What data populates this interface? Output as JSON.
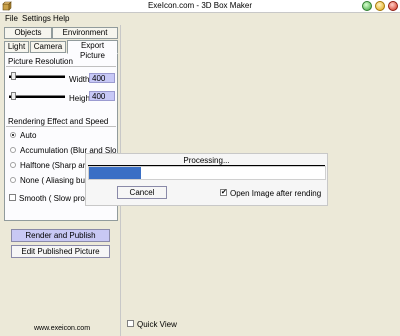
{
  "window": {
    "title": "ExeIcon.com - 3D Box Maker"
  },
  "menu": {
    "file": "File",
    "settings": "Settings",
    "help": "Help"
  },
  "tabs_row1": [
    "Objects",
    "Environment"
  ],
  "tabs_row2": [
    "Light",
    "Camera",
    "Export Picture"
  ],
  "active_tab": "Export Picture",
  "resolution": {
    "title": "Picture Resolution",
    "width_label": "Width",
    "width_value": "400",
    "height_label": "Height",
    "height_value": "400"
  },
  "rendering": {
    "title": "Rendering Effect and Speed",
    "options": [
      "Auto",
      "Accumulation (Blur and Slo",
      "Halftone (Sharp and",
      "None ( Aliasing but Q"
    ],
    "selected": "Auto",
    "smooth_label": "Smooth ( Slow proce"
  },
  "buttons": {
    "render": "Render and Publish",
    "edit": "Edit Published Picture"
  },
  "footer": {
    "url": "www.exeicon.com"
  },
  "canvas": {
    "quick_view_label": "Quick View",
    "quick_view_checked": false
  },
  "dialog": {
    "title": "Processing...",
    "progress": 0.22,
    "cancel_label": "Cancel",
    "open_after_label": "Open Image after rending",
    "open_after_checked": true
  },
  "colors": {
    "progress": "#3a6fc5",
    "highlight_button": "#c8c8f4",
    "number_box": "#c7c8f6"
  }
}
